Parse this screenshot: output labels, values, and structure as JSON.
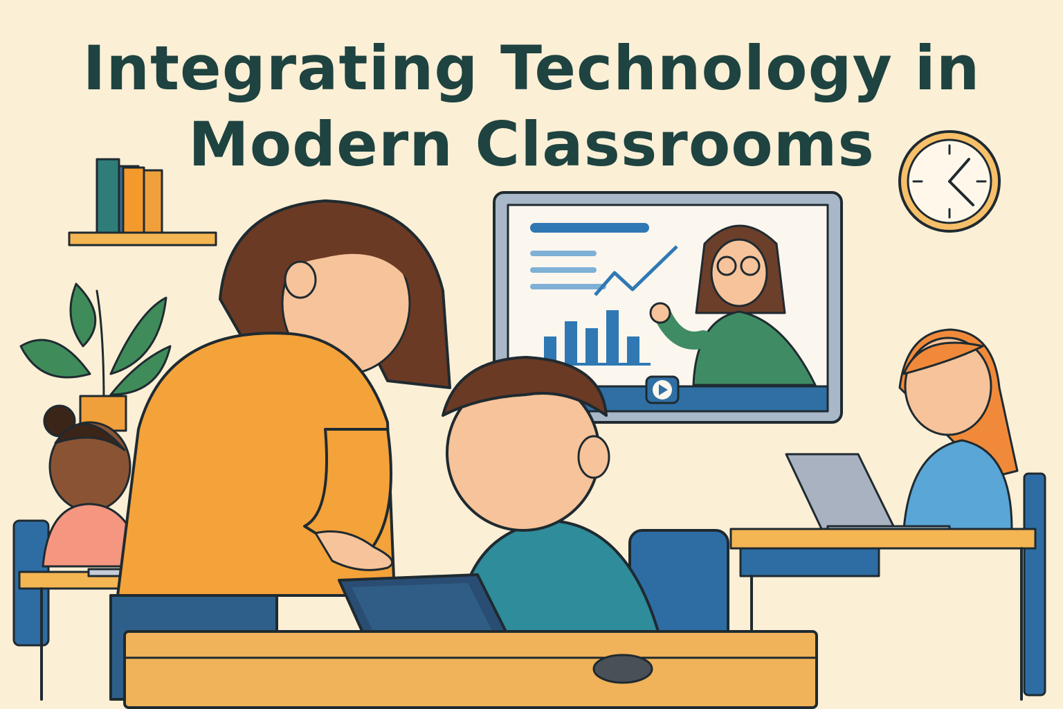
{
  "title": {
    "line1": "Integrating Technology in",
    "line2": "Modern Classrooms"
  },
  "colors": {
    "background": "#fbefd6",
    "title": "#1e4340",
    "teacher_sweater": "#f4a23a",
    "screen_frame": "#a8b8c8",
    "desk_wood": "#f0b35a",
    "chair_blue": "#2e6da4"
  },
  "icons": {
    "clock": "clock-icon",
    "play": "play-icon",
    "laptop_logo": "apple-icon"
  }
}
